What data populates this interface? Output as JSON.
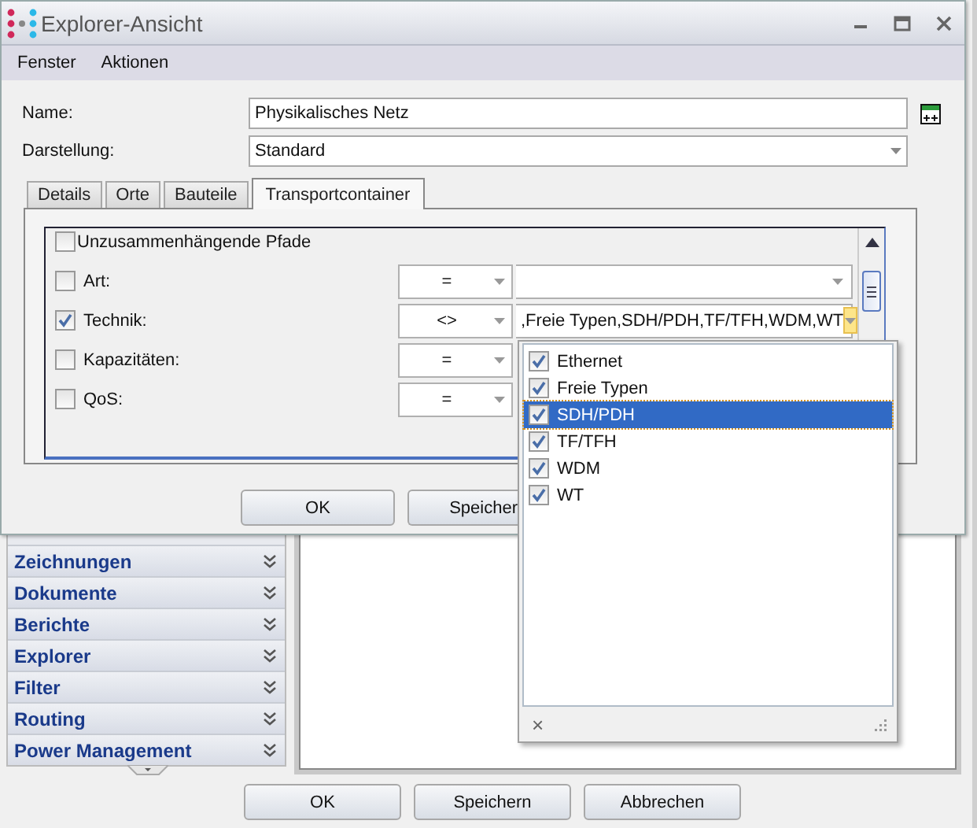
{
  "window": {
    "title": "Explorer-Ansicht"
  },
  "menu": [
    {
      "label": "Fenster"
    },
    {
      "label": "Aktionen"
    }
  ],
  "form": {
    "name_label": "Name:",
    "name_value": "Physikalisches Netz",
    "view_label": "Darstellung:",
    "view_value": "Standard"
  },
  "tabs": [
    {
      "label": "Details",
      "selected": false
    },
    {
      "label": "Orte",
      "selected": false
    },
    {
      "label": "Bauteile",
      "selected": false
    },
    {
      "label": "Transportcontainer",
      "selected": true
    }
  ],
  "filters": [
    {
      "kind": "flag",
      "label": "Unzusammenhängende Pfade",
      "checked": false
    },
    {
      "kind": "condition",
      "label": "Art:",
      "checked": false,
      "operator": "=",
      "open": false
    },
    {
      "kind": "condition",
      "label": "Technik:",
      "checked": true,
      "operator": "<>",
      "value": ",Freie Typen,SDH/PDH,TF/TFH,WDM,WT",
      "open": true
    },
    {
      "kind": "operator_only",
      "label": "Kapazitäten:",
      "checked": false,
      "operator": "="
    },
    {
      "kind": "operator_only",
      "label": "QoS:",
      "checked": false,
      "operator": "="
    }
  ],
  "dropdown": {
    "items": [
      {
        "label": "Ethernet",
        "checked": true,
        "selected": false
      },
      {
        "label": "Freie Typen",
        "checked": true,
        "selected": false
      },
      {
        "label": "SDH/PDH",
        "checked": true,
        "selected": true
      },
      {
        "label": "TF/TFH",
        "checked": true,
        "selected": false
      },
      {
        "label": "WDM",
        "checked": true,
        "selected": false
      },
      {
        "label": "WT",
        "checked": true,
        "selected": false
      }
    ],
    "close": "×"
  },
  "dialog_buttons": [
    "OK",
    "Speicher"
  ],
  "sidebar": {
    "items": [
      {
        "label": "Zeichnungen"
      },
      {
        "label": "Dokumente"
      },
      {
        "label": "Berichte"
      },
      {
        "label": "Explorer"
      },
      {
        "label": "Filter"
      },
      {
        "label": "Routing"
      },
      {
        "label": "Power Management"
      }
    ]
  },
  "buttons": [
    "OK",
    "Speichern",
    "Abbrechen"
  ]
}
